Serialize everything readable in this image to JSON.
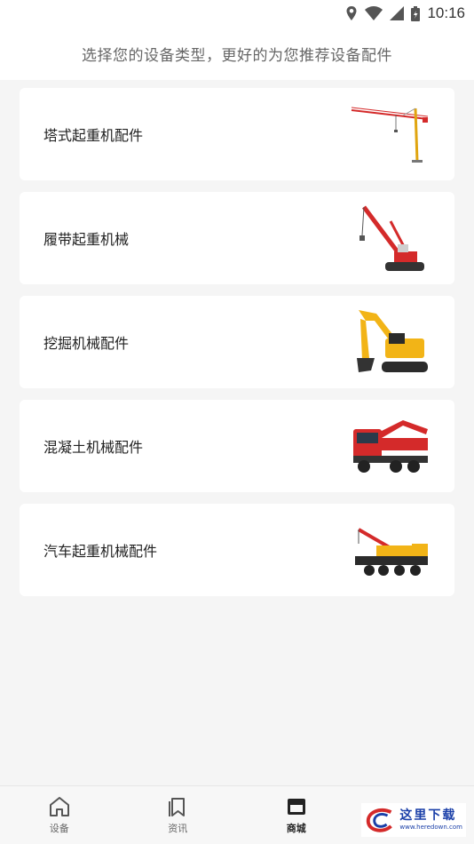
{
  "status_bar": {
    "time": "10:16"
  },
  "header": {
    "subtitle": "选择您的设备类型，更好的为您推荐设备配件"
  },
  "categories": [
    {
      "label": "塔式起重机配件",
      "icon": "tower-crane-image"
    },
    {
      "label": "履带起重机械",
      "icon": "crawler-crane-image"
    },
    {
      "label": "挖掘机械配件",
      "icon": "excavator-image"
    },
    {
      "label": "混凝土机械配件",
      "icon": "concrete-pump-truck-image"
    },
    {
      "label": "汽车起重机械配件",
      "icon": "truck-crane-image"
    }
  ],
  "tabs": [
    {
      "label": "设备",
      "icon": "home-icon"
    },
    {
      "label": "资讯",
      "icon": "bookmark-icon"
    },
    {
      "label": "商城",
      "icon": "store-icon",
      "active": true
    },
    {
      "label": "",
      "icon": "profile-icon"
    }
  ],
  "watermark": {
    "text": "这里下载",
    "url": "www.heredown.com"
  },
  "colors": {
    "accent_red": "#d42a2a",
    "accent_yellow": "#f2b417",
    "text_primary": "#222222",
    "text_secondary": "#666666"
  }
}
